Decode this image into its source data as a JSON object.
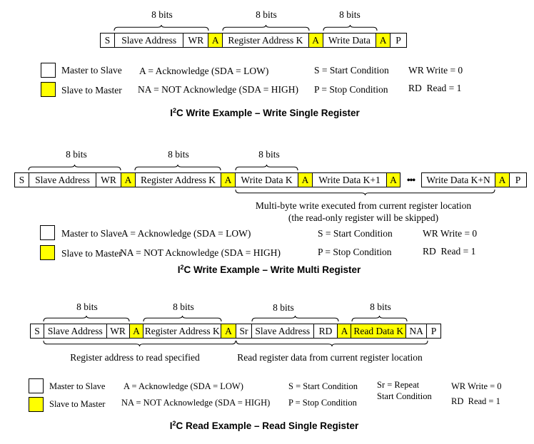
{
  "colors": {
    "slave_to_master": "#ffff00",
    "master_to_slave": "#ffffff"
  },
  "examples": [
    {
      "title_prefix": "I",
      "title_sup": "2",
      "title_rest": "C Write Example – Write Single Register",
      "frame": [
        {
          "label": "S",
          "color": "white"
        },
        {
          "label": "Slave Address",
          "color": "white"
        },
        {
          "label": "WR",
          "color": "white"
        },
        {
          "label": "A",
          "color": "yellow"
        },
        {
          "label": "Register Address K",
          "color": "white"
        },
        {
          "label": "A",
          "color": "yellow"
        },
        {
          "label": "Write Data",
          "color": "white"
        },
        {
          "label": "A",
          "color": "yellow"
        },
        {
          "label": "P",
          "color": "white"
        }
      ],
      "top_braces": [
        "8 bits",
        "8 bits",
        "8 bits"
      ],
      "bottom_notes": [],
      "legend": {
        "master_to_slave": "Master to Slave",
        "slave_to_master": "Slave to Master",
        "ack": "A = Acknowledge (SDA = LOW)",
        "nack": "NA = NOT Acknowledge (SDA = HIGH)",
        "start": "S = Start Condition",
        "stop": "P = Stop Condition",
        "write": "WR Write = 0",
        "read": "RD  Read = 1"
      }
    },
    {
      "title_prefix": "I",
      "title_sup": "2",
      "title_rest": "C Write Example – Write Multi Register",
      "frame": [
        {
          "label": "S",
          "color": "white"
        },
        {
          "label": "Slave Address",
          "color": "white"
        },
        {
          "label": "WR",
          "color": "white"
        },
        {
          "label": "A",
          "color": "yellow"
        },
        {
          "label": "Register Address K",
          "color": "white"
        },
        {
          "label": "A",
          "color": "yellow"
        },
        {
          "label": "Write Data K",
          "color": "white"
        },
        {
          "label": "A",
          "color": "yellow"
        },
        {
          "label": "Write Data K+1",
          "color": "white"
        },
        {
          "label": "A",
          "color": "yellow"
        },
        {
          "label": "•••",
          "color": "none"
        },
        {
          "label": "Write Data K+N",
          "color": "white"
        },
        {
          "label": "A",
          "color": "yellow"
        },
        {
          "label": "P",
          "color": "white"
        }
      ],
      "top_braces": [
        "8 bits",
        "8 bits",
        "8 bits"
      ],
      "bottom_notes": [
        "Multi-byte write executed from current register location",
        "(the read-only register will be skipped)"
      ],
      "legend": {
        "master_to_slave": "Master to Slave",
        "slave_to_master": "Slave to Master",
        "ack": "A = Acknowledge (SDA = LOW)",
        "nack": "NA = NOT Acknowledge (SDA = HIGH)",
        "start": "S = Start Condition",
        "stop": "P = Stop Condition",
        "write": "WR Write = 0",
        "read": "RD  Read = 1"
      }
    },
    {
      "title_prefix": "I",
      "title_sup": "2",
      "title_rest": "C Read Example – Read Single Register",
      "frame": [
        {
          "label": "S",
          "color": "white"
        },
        {
          "label": "Slave Address",
          "color": "white"
        },
        {
          "label": "WR",
          "color": "white"
        },
        {
          "label": "A",
          "color": "yellow"
        },
        {
          "label": "Register Address K",
          "color": "white"
        },
        {
          "label": "A",
          "color": "yellow"
        },
        {
          "label": "Sr",
          "color": "white"
        },
        {
          "label": "Slave Address",
          "color": "white"
        },
        {
          "label": "RD",
          "color": "white"
        },
        {
          "label": "A",
          "color": "yellow"
        },
        {
          "label": "Read Data K",
          "color": "yellow"
        },
        {
          "label": "NA",
          "color": "white"
        },
        {
          "label": "P",
          "color": "white"
        }
      ],
      "top_braces": [
        "8 bits",
        "8 bits",
        "8 bits",
        "8 bits"
      ],
      "bottom_notes": [
        "Register address to read specified",
        "Read register data from current register location"
      ],
      "legend": {
        "master_to_slave": "Master to Slave",
        "slave_to_master": "Slave to Master",
        "ack": "A = Acknowledge (SDA = LOW)",
        "nack": "NA = NOT Acknowledge (SDA = HIGH)",
        "start": "S = Start Condition",
        "stop": "P = Stop Condition",
        "repeat_start_1": "Sr = Repeat",
        "repeat_start_2": "Start Condition",
        "write": "WR Write = 0",
        "read": "RD  Read = 1"
      }
    }
  ]
}
